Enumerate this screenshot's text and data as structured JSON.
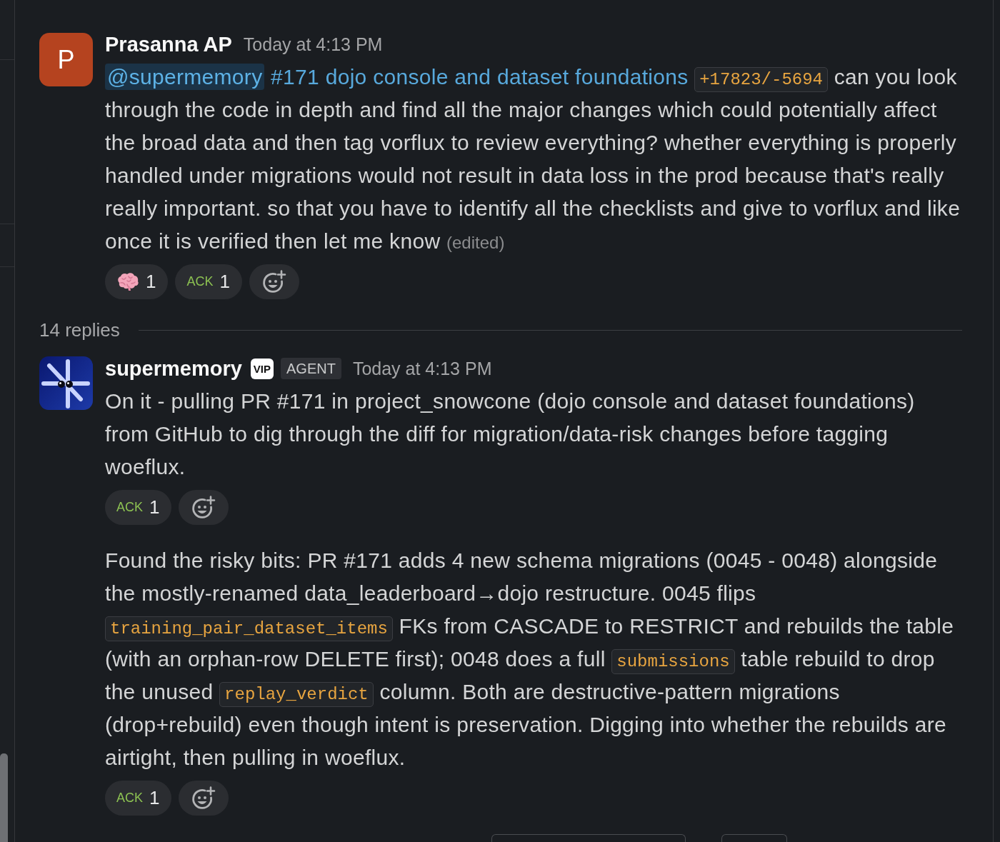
{
  "parent": {
    "author": "Prasanna AP",
    "avatar": {
      "kind": "letter",
      "text": "P"
    },
    "time": "Today at 4:13 PM",
    "posts": [
      {
        "body": [
          {
            "kind": "mention",
            "text": "@supermemory"
          },
          {
            "kind": "link",
            "text": "#171 dojo console and dataset foundations"
          },
          {
            "kind": "code",
            "text": "+17823/-5694"
          },
          {
            "kind": "text",
            "text": " can you look through the code in depth and find all the major changes which could potentially affect the broad data and then tag vorflux to review everything? whether everything is properly handled under migrations would not result in data loss in the prod because that's really really important. so that you have to identify all the checklists and give to vorflux and like once it is verified then let me know"
          }
        ],
        "edited": "(edited)",
        "reactions": [
          {
            "kind": "emoji",
            "count": "1"
          },
          {
            "kind": "label",
            "label": "ACK",
            "count": "1"
          }
        ]
      }
    ]
  },
  "replies_divider": {
    "label": "14 replies"
  },
  "replies": [
    {
      "author": "supermemory",
      "avatar": {
        "kind": "logo"
      },
      "badges": [
        {
          "kind": "vip",
          "text": "VIP"
        },
        {
          "kind": "tag",
          "text": "AGENT"
        }
      ],
      "time": "Today at 4:13 PM",
      "posts": [
        {
          "body": [
            {
              "kind": "text",
              "text": "On it - pulling PR #171 in project_snowcone (dojo console and dataset foundations) from GitHub to dig through the diff for migration/data-risk changes before tagging woeflux."
            }
          ],
          "reactions": [
            {
              "kind": "label",
              "label": "ACK",
              "count": "1"
            }
          ]
        },
        {
          "body": [
            {
              "kind": "text",
              "text": "Found the risky bits: PR #171 adds 4 new schema migrations (0045 - 0048) alongside the mostly-renamed data_leaderboard→dojo restructure. 0045 flips"
            },
            {
              "kind": "code",
              "text": "training_pair_dataset_items"
            },
            {
              "kind": "text",
              "text": "FKs from CASCADE to RESTRICT and rebuilds the table (with an orphan-row DELETE first); 0048 does a full"
            },
            {
              "kind": "code",
              "text": "submissions"
            },
            {
              "kind": "text",
              "text": "table rebuild to drop the unused"
            },
            {
              "kind": "code",
              "text": "replay_verdict"
            },
            {
              "kind": "text",
              "text": "column. Both are destructive-pattern migrations (drop+rebuild) even though intent is preservation. Digging into whether the rebuilds are airtight, then pulling in woeflux."
            }
          ],
          "reactions": [
            {
              "kind": "label",
              "label": "ACK",
              "count": "1"
            }
          ]
        }
      ]
    }
  ]
}
